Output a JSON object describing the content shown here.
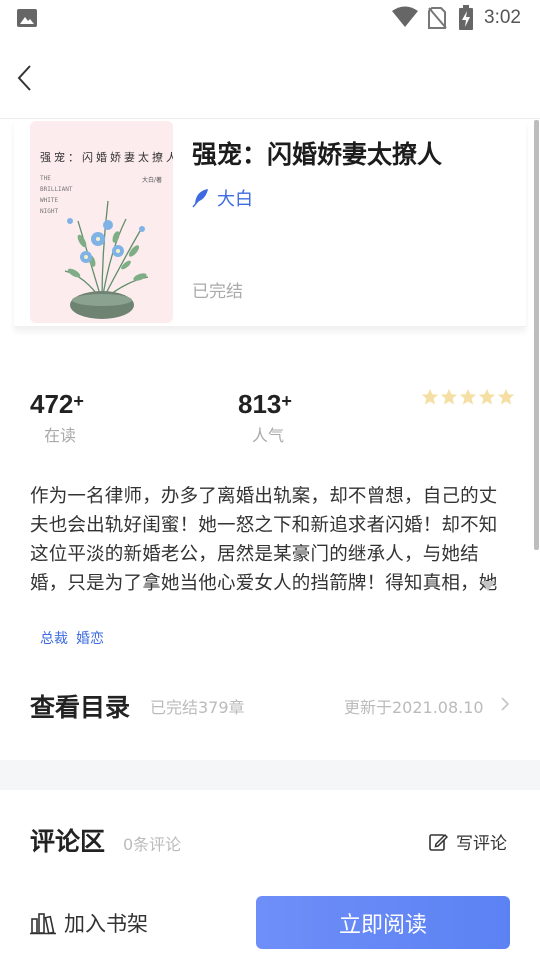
{
  "status_bar": {
    "time": "3:02",
    "icons": [
      "image-icon",
      "wifi-icon",
      "no-sim-icon",
      "battery-charging-icon"
    ]
  },
  "header": {
    "back_icon": "chevron-left-icon"
  },
  "book": {
    "title": "强宠：闪婚娇妻太撩人",
    "author": "大白",
    "author_icon": "feather-icon",
    "status": "已完结",
    "cover": {
      "title": "强宠：闪婚娇妻太撩人",
      "author": "大白/著",
      "english_lines": [
        "THE",
        "BRILLIANT",
        "WHITE",
        "NIGHT"
      ]
    }
  },
  "stats": {
    "reading": {
      "value": "472",
      "suffix": "+",
      "label": "在读"
    },
    "popularity": {
      "value": "813",
      "suffix": "+",
      "label": "人气"
    },
    "rating_stars": 5,
    "star_color": "#f5dfa4"
  },
  "synopsis": "作为一名律师，办多了离婚出轨案，却不曾想，自己的丈夫也会出轨好闺蜜！她一怒之下和新追求者闪婚！却不知这位平淡的新婚老公，居然是某豪门的继承人，与她结婚，只是为了拿她当他心爱女人的挡箭牌！得知真相，她甩给他一张离婚协议：“咱们离婚！”他翻身...",
  "tags": [
    "总裁",
    "婚恋"
  ],
  "catalog": {
    "title": "查看目录",
    "chapters": "已完结379章",
    "updated": "更新于2021.08.10"
  },
  "comments": {
    "title": "评论区",
    "count": "0条评论",
    "write_label": "写评论"
  },
  "bottom": {
    "add_shelf": "加入书架",
    "read_now": "立即阅读"
  },
  "colors": {
    "accent": "#3d6be0",
    "button_gradient_start": "#6f8ef8",
    "button_gradient_end": "#5b82f3"
  }
}
